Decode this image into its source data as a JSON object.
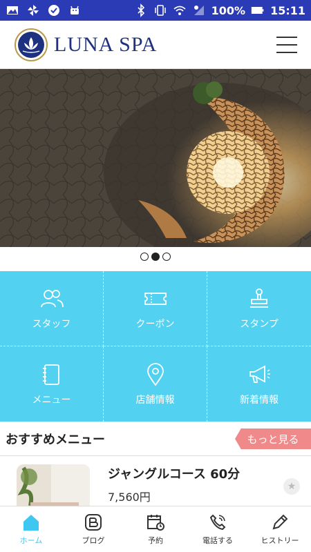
{
  "status_bar": {
    "battery": "100%",
    "time": "15:11",
    "left_icons": [
      "image-icon",
      "pinwheel-icon",
      "check-icon",
      "android-icon"
    ],
    "right_icons": [
      "bluetooth-icon",
      "vibrate-icon",
      "wifi-icon",
      "signal-icon",
      "battery-icon"
    ]
  },
  "header": {
    "logo_text": "LUNA SPA",
    "menu_icon": "hamburger-icon"
  },
  "carousel": {
    "dots_total": 3,
    "active_index": 1
  },
  "grid_menu": [
    {
      "label": "スタッフ",
      "icon": "people-icon"
    },
    {
      "label": "クーポン",
      "icon": "ticket-icon"
    },
    {
      "label": "スタンプ",
      "icon": "stamp-icon"
    },
    {
      "label": "メニュー",
      "icon": "notebook-icon"
    },
    {
      "label": "店舗情報",
      "icon": "location-pin-icon"
    },
    {
      "label": "新着情報",
      "icon": "megaphone-icon"
    }
  ],
  "recommend": {
    "title": "おすすめメニュー",
    "more_label": "もっと見る",
    "items": [
      {
        "name": "ジャングルコース 60分",
        "price": "7,560円"
      }
    ]
  },
  "bottom_nav": [
    {
      "label": "ホーム",
      "icon": "home-icon",
      "active": true
    },
    {
      "label": "ブログ",
      "icon": "blog-icon",
      "active": false
    },
    {
      "label": "予約",
      "icon": "calendar-icon",
      "active": false
    },
    {
      "label": "電話する",
      "icon": "phone-icon",
      "active": false
    },
    {
      "label": "ヒストリー",
      "icon": "pencil-icon",
      "active": false
    }
  ],
  "colors": {
    "status_bar": "#2b3bb5",
    "grid_bg": "#52d1f1",
    "more_btn": "#f08a8a",
    "logo_text": "#1e3180",
    "nav_active": "#3ec7f0"
  }
}
